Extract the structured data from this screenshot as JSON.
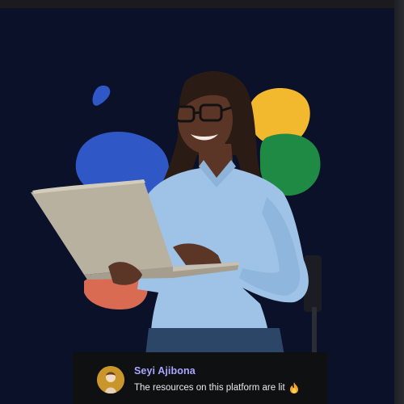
{
  "testimonial": {
    "author_name": "Seyi Ajibona",
    "quote": "The resources on this platform are lit",
    "emoji_icon": "fire-icon",
    "avatar_icon": "person-avatar"
  },
  "colors": {
    "background": "#0a1128",
    "blob_blue": "#2f57c5",
    "blob_yellow": "#f3b92e",
    "blob_green": "#1f8a43",
    "blob_coral": "#d96b52",
    "name_accent": "#a9a6ff"
  }
}
